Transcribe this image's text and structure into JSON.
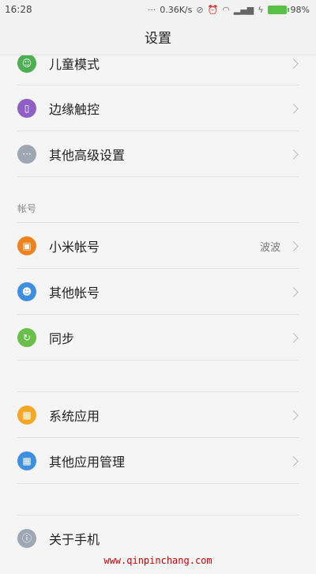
{
  "status_bar": {
    "time": "16:28",
    "network_speed": "0.36K/s",
    "battery": "98%"
  },
  "header": {
    "title": "设置"
  },
  "sections": {
    "account_title": "帐号"
  },
  "items": [
    {
      "label": "儿童模式",
      "icon": "child-mode-icon",
      "color": "#4caf50"
    },
    {
      "label": "边缘触控",
      "icon": "edge-touch-icon",
      "color": "#8e5fc4"
    },
    {
      "label": "其他高级设置",
      "icon": "more-settings-icon",
      "color": "#9ea7b3"
    },
    {
      "label": "小米帐号",
      "value": "波波",
      "icon": "mi-account-icon",
      "color": "#f0821e"
    },
    {
      "label": "其他帐号",
      "icon": "other-accounts-icon",
      "color": "#3f8fe0"
    },
    {
      "label": "同步",
      "icon": "sync-icon",
      "color": "#6abf4b"
    },
    {
      "label": "系统应用",
      "icon": "system-apps-icon",
      "color": "#f5a623"
    },
    {
      "label": "其他应用管理",
      "icon": "app-management-icon",
      "color": "#3f8fe0"
    },
    {
      "label": "关于手机",
      "icon": "about-phone-icon",
      "color": "#9ea7b3"
    }
  ],
  "watermark": "www.qinpinchang.com"
}
